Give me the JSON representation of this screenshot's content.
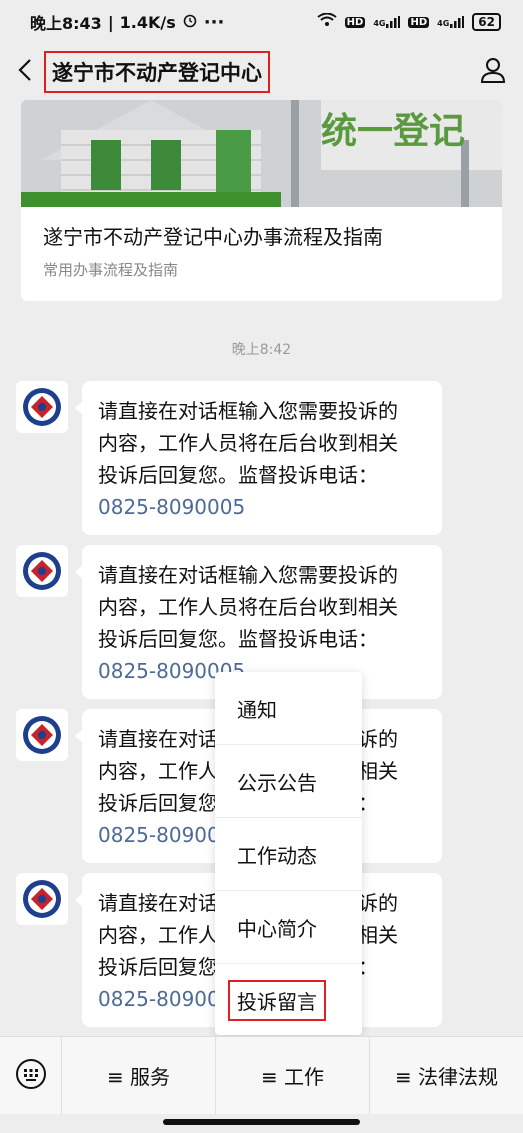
{
  "status_bar": {
    "time": "晚上8:43",
    "speed": "1.4K/s",
    "dots": "···",
    "network_1": "4G",
    "network_2": "4G",
    "battery": "62"
  },
  "nav": {
    "title": "遂宁市不动产登记中心",
    "back_icon": "chevron-left-icon",
    "profile_icon": "person-icon"
  },
  "article": {
    "image_caption": "统一登记",
    "title": "遂宁市不动产登记中心办事流程及指南",
    "subtitle": "常用办事流程及指南"
  },
  "timestamp": "晚上8:42",
  "messages": [
    {
      "line1": "请直接在对话框输入您需要投诉的",
      "line2": "内容，工作人员将在后台收到相关",
      "line3": "投诉后回复您。监督投诉电话：",
      "phone": "0825-8090005"
    },
    {
      "line1": "请直接在对话框输入您需要投诉的",
      "line2": "内容，工作人员将在后台收到相关",
      "line3": "投诉后回复您。监督投诉电话：",
      "phone": "0825-8090005"
    },
    {
      "line1": "请直接在对话框输入您需要投诉的",
      "line2": "内容，工作人员将在后台收到相关",
      "line3": "投诉后回复您。监督投诉电话：",
      "phone": "0825-8090005"
    },
    {
      "line1": "请直接在对话框输入您需要投诉的",
      "line2": "内容，工作人员将在后台收到相关",
      "line3": "投诉后回复您。监督投诉电话：",
      "phone": "0825-8090005"
    }
  ],
  "popup_menu": {
    "items": [
      "通知",
      "公示公告",
      "工作动态",
      "中心简介",
      "投诉留言"
    ],
    "highlighted": "投诉留言"
  },
  "bottom_bar": {
    "keyboard_icon": "keyboard-icon",
    "menus": [
      "≡ 服务",
      "≡ 工作",
      "≡ 法律法规"
    ]
  },
  "colors": {
    "highlight_border": "#e02020",
    "phone_link": "#4e6b96",
    "background": "#ededed"
  }
}
